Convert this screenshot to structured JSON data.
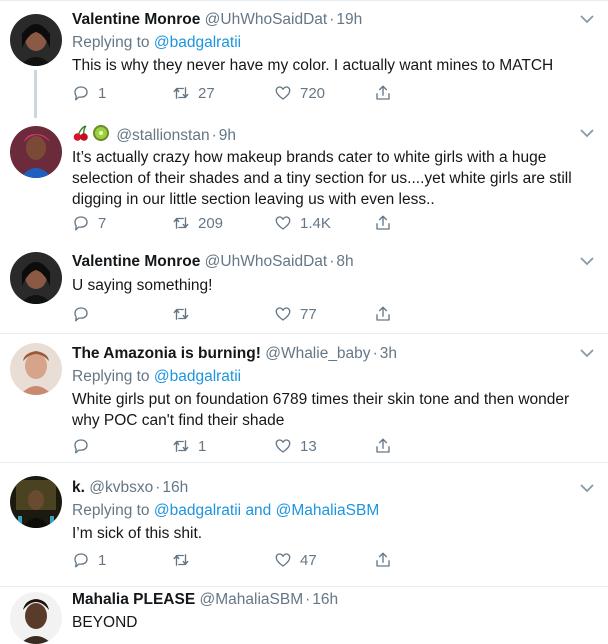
{
  "tweets": [
    {
      "name": "Valentine Monroe",
      "handle": "@UhWhoSaidDat",
      "time": "19h",
      "reply_prefix": "Replying to",
      "reply_to": "@badgalratii",
      "text": "This is why they never have my color. I actually want mines to MATCH",
      "replies": "1",
      "retweets": "27",
      "likes": "720"
    },
    {
      "name": "",
      "handle": "@stallionstan",
      "time": "9h",
      "text": "It’s actually crazy how makeup brands cater to white girls with a huge selection of their shades and a tiny section for us....yet white girls are still digging in our little section leaving us with even less..",
      "replies": "7",
      "retweets": "209",
      "likes": "1.4K",
      "name_icons": [
        "cherries-icon",
        "kiwi-icon"
      ]
    },
    {
      "name": "Valentine Monroe",
      "handle": "@UhWhoSaidDat",
      "time": "8h",
      "text": "U saying something!",
      "replies": "",
      "retweets": "",
      "likes": "77"
    },
    {
      "name": "The Amazonia is burning!",
      "handle": "@Whalie_baby",
      "time": "3h",
      "reply_prefix": "Replying to",
      "reply_to": "@badgalratii",
      "text": "White girls put on foundation 6789 times their skin tone and then wonder why POC can't find their shade",
      "replies": "",
      "retweets": "1",
      "likes": "13"
    },
    {
      "name": "k.",
      "handle": "@kvbsxo",
      "time": "16h",
      "reply_prefix": "Replying to",
      "reply_to": "@badgalratii",
      "reply_and": "and",
      "reply_to_2": "@MahaliaSBM",
      "text": "I’m sick of this shit.",
      "replies": "1",
      "retweets": "",
      "likes": "47"
    },
    {
      "name": "Mahalia PLEASE",
      "handle": "@MahaliaSBM",
      "time": "16h",
      "text": "BEYOND"
    }
  ],
  "separator": "·",
  "colors": {
    "text": "#14171a",
    "muted": "#657786",
    "link": "#1b95e0",
    "border": "#e6ecf0"
  }
}
